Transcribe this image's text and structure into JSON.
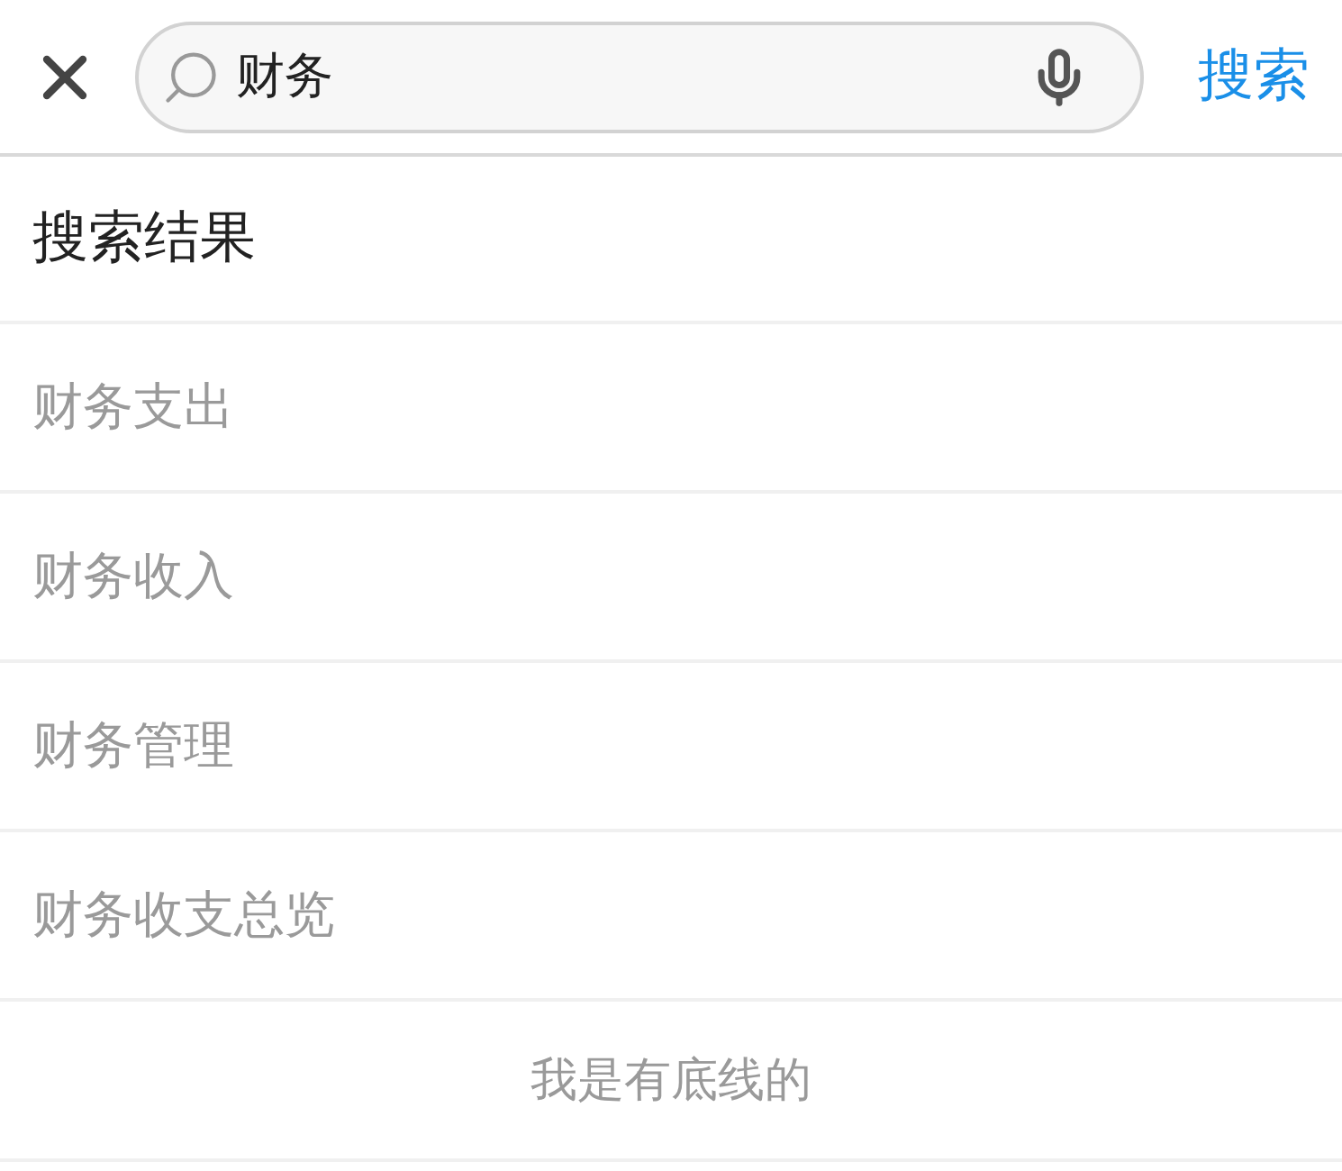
{
  "search": {
    "value": "财务",
    "submit": "搜索"
  },
  "results_title": "搜索结果",
  "results": [
    "财务支出",
    "财务收入",
    "财务管理",
    "财务收支总览"
  ],
  "footer": "我是有底线的"
}
